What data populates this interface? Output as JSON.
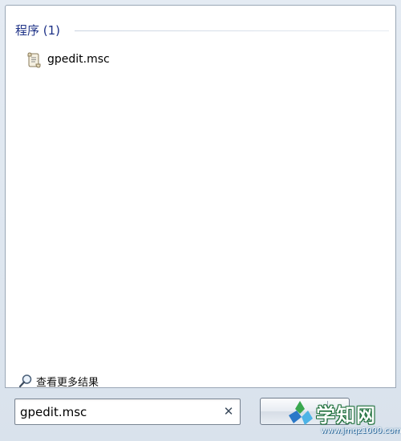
{
  "results": {
    "section_title": "程序 (1)",
    "items": [
      {
        "label": "gpedit.msc",
        "icon": "script-file-icon"
      }
    ],
    "see_more_label": "查看更多结果",
    "see_more_icon": "search-icon"
  },
  "search": {
    "value": "gpedit.msc",
    "clear_icon": "✕"
  },
  "shutdown": {
    "label_partial": "关"
  },
  "watermark": {
    "text": "学知网",
    "url": "www.jmqz1000.com"
  },
  "colors": {
    "section_title": "#1e3287",
    "frame": "#d9e2ec",
    "results_bg": "#ffffff",
    "watermark_green": "#2e9a4a",
    "watermark_blue": "#2a78c8"
  }
}
